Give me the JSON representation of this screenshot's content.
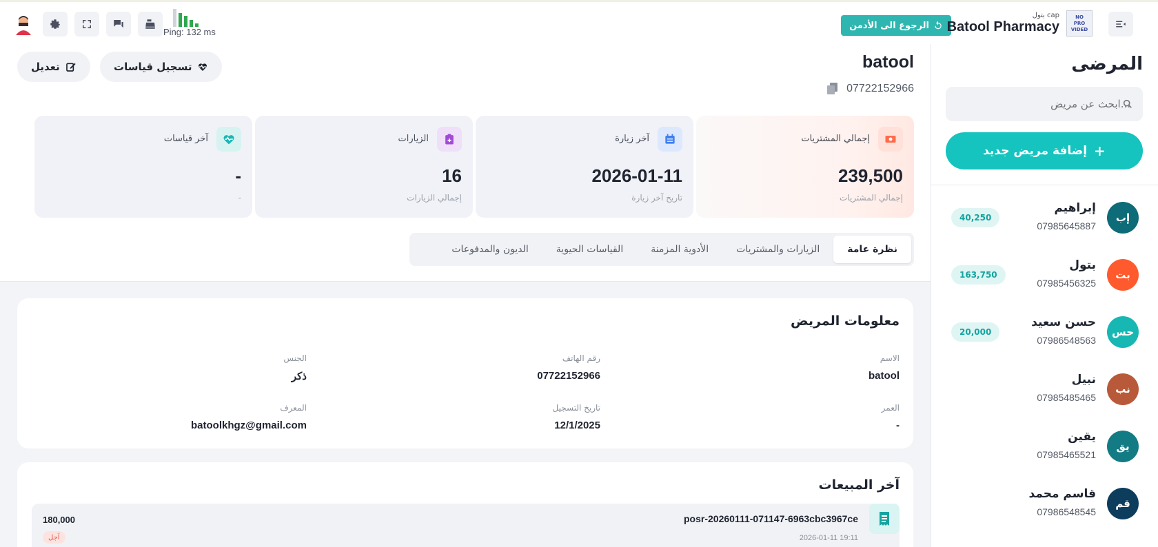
{
  "topbar": {
    "ping_label": "Ping: 132 ms",
    "admin_back_label": "الرجوع الى الأدمن",
    "brand_sub": "بتول cap",
    "brand_name": "Batool Pharmacy",
    "logo_text": "NO\nPRO\nVIDED",
    "icons": [
      "avatar-icon",
      "settings-icon",
      "fullscreen-icon",
      "chat-icon",
      "cash-register-icon",
      "signal-icon",
      "undo-icon",
      "menu-collapse-icon"
    ]
  },
  "sidebar": {
    "title": "المرضى",
    "search_placeholder": "ابحث عن مريض...",
    "add_label": "إضافة مريض جديد",
    "patients": [
      {
        "initials": "إب",
        "name": "إبراهيم",
        "phone": "07985645887",
        "badge": "40,250",
        "color": "#0e6b78"
      },
      {
        "initials": "بت",
        "name": "بتول",
        "phone": "07985456325",
        "badge": "163,750",
        "color": "#ff5a2e"
      },
      {
        "initials": "حس",
        "name": "حسن سعيد",
        "phone": "07986548563",
        "badge": "20,000",
        "color": "#17b7b3"
      },
      {
        "initials": "نب",
        "name": "نبيل",
        "phone": "07985485465",
        "badge": "",
        "color": "#b85a3a"
      },
      {
        "initials": "يق",
        "name": "يقين",
        "phone": "07985465521",
        "badge": "",
        "color": "#137b84"
      },
      {
        "initials": "قم",
        "name": "قاسم محمد",
        "phone": "07986548545",
        "badge": "",
        "color": "#0d3d5c"
      }
    ]
  },
  "patient": {
    "name": "batool",
    "phone": "07722152966",
    "edit_label": "تعديل",
    "measure_label": "تسجيل قياسات"
  },
  "stats": [
    {
      "label": "إجمالي المشتريات",
      "value": "239,500",
      "sub": "إجمالي المشتريات",
      "icon": "money-icon",
      "color": "#ff6b4a",
      "bg": "#ffe1da"
    },
    {
      "label": "آخر زيارة",
      "value": "2026-01-11",
      "sub": "تاريخ آخر زيارة",
      "icon": "calendar-icon",
      "color": "#3f7ff0",
      "bg": "#dce8fd"
    },
    {
      "label": "الزيارات",
      "value": "16",
      "sub": "إجمالي الزيارات",
      "icon": "clipboard-icon",
      "color": "#a24ad6",
      "bg": "#efdff9"
    },
    {
      "label": "آخر قياسات",
      "value": "-",
      "sub": "-",
      "icon": "heart-pulse-icon",
      "color": "#17b7b3",
      "bg": "#d6f3f2"
    }
  ],
  "tabs": [
    "نظرة عامة",
    "الزيارات والمشتريات",
    "الأدوية المزمنة",
    "القياسات الحيوية",
    "الديون والمدفوعات"
  ],
  "info": {
    "title": "معلومات المريض",
    "fields": [
      {
        "label": "الاسم",
        "value": "batool"
      },
      {
        "label": "رقم الهاتف",
        "value": "07722152966"
      },
      {
        "label": "الجنس",
        "value": "ذكر"
      },
      {
        "label": "العمر",
        "value": "-"
      },
      {
        "label": "تاريخ التسجيل",
        "value": "12/1/2025"
      },
      {
        "label": "المعرف",
        "value": "batoolkhgz@gmail.com"
      }
    ]
  },
  "sales": {
    "title": "آخر المبيعات",
    "items": [
      {
        "ref": "posr-20260111-071147-6963cbc3967ce",
        "date": "2026-01-11 19:11",
        "amount": "180,000",
        "tag": "آجل"
      }
    ]
  }
}
